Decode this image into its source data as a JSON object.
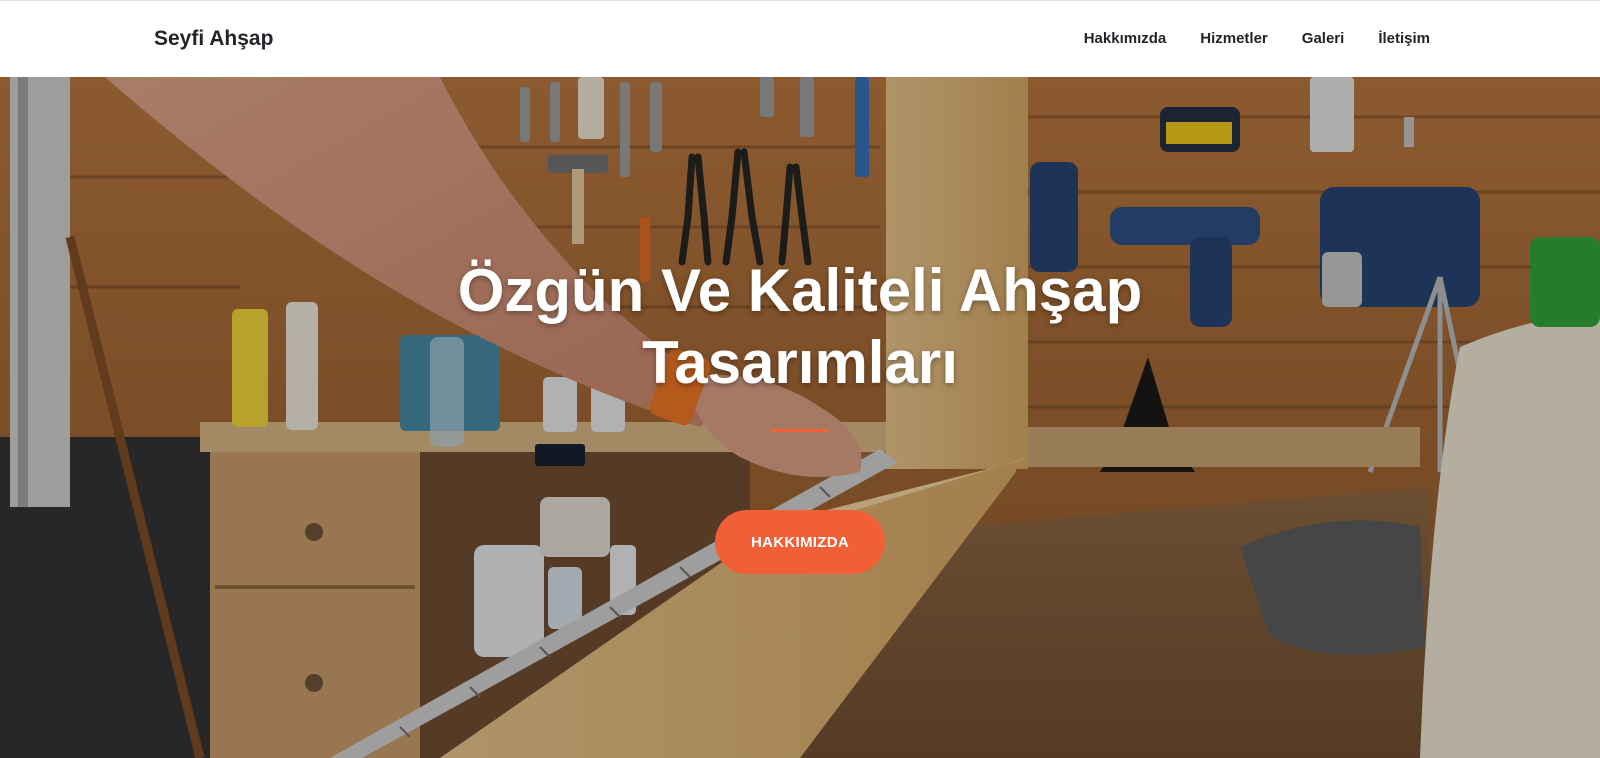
{
  "navbar": {
    "brand": "Seyfi Ahşap",
    "links": [
      "Hakkımızda",
      "Hizmetler",
      "Galeri",
      "İletişim"
    ]
  },
  "hero": {
    "title": "Özgün Ve Kaliteli Ahşap Tasarımları",
    "button_label": "HAKKIMIZDA"
  },
  "colors": {
    "accent": "#f4623a",
    "button": "#f05f37",
    "navbar_bg": "#ffffff",
    "nav_text": "#212529"
  },
  "background_image": "workshop-photo: hands measuring a wooden board with a tape measure in front of a pegboard tool wall"
}
